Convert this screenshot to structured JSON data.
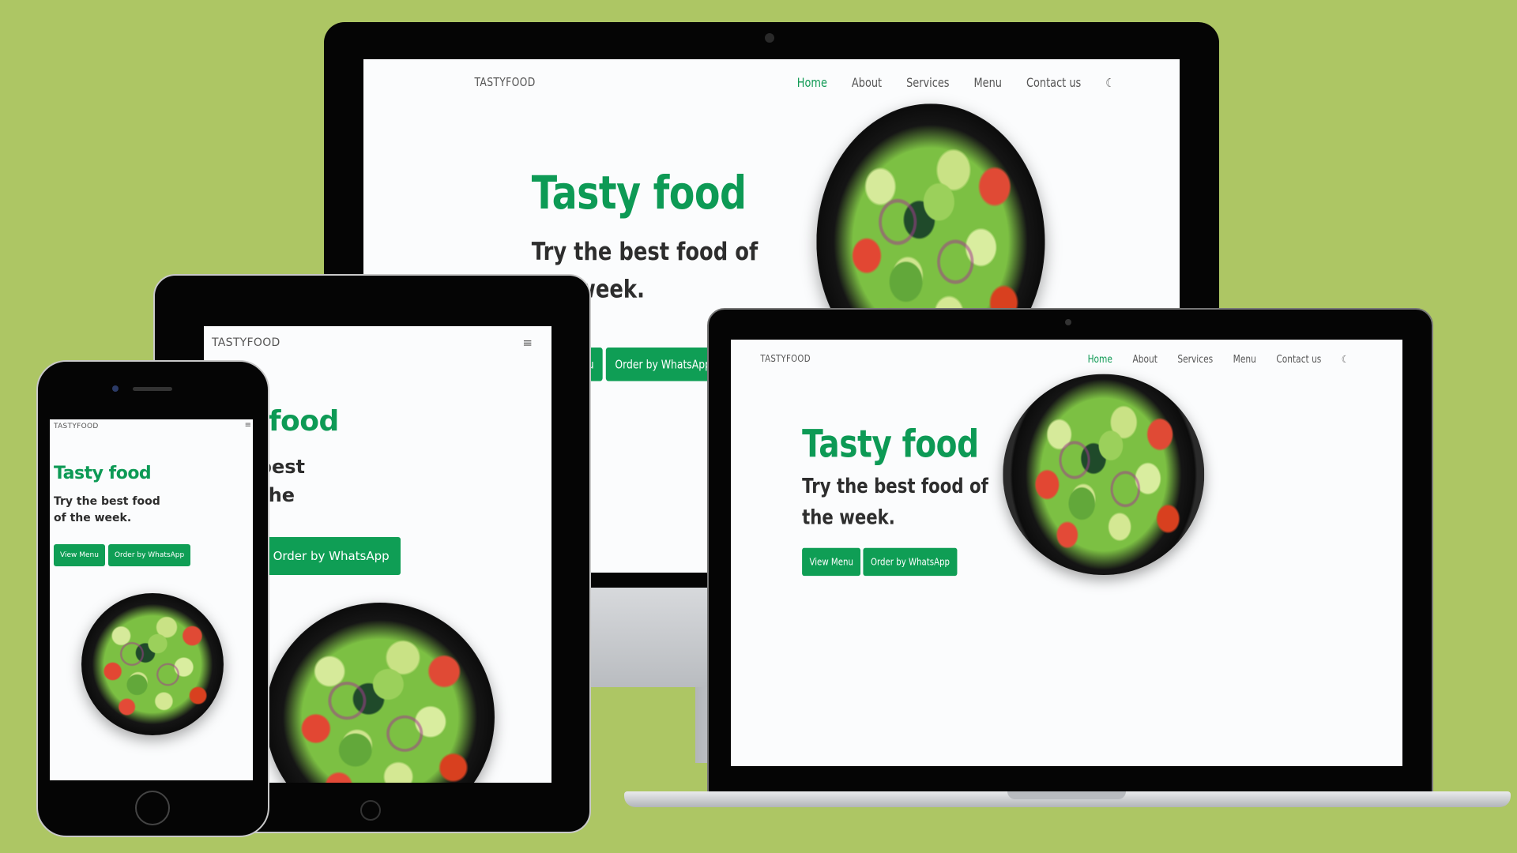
{
  "site": {
    "logo": "TASTYFOOD",
    "nav": [
      "Home",
      "About",
      "Services",
      "Menu",
      "Contact us"
    ],
    "active_nav": "Home",
    "theme_icon": "moon-icon",
    "menu_icon": "hamburger-icon",
    "hero_title": "Tasty food",
    "hero_subtitle": "Try the best food of the week.",
    "btn_menu": "View Menu",
    "btn_whatsapp": "Order by WhatsApp",
    "image": "salad-bowl"
  },
  "colors": {
    "background": "#adc664",
    "accent": "#0f9e55",
    "text_dark": "#2d2d2d"
  }
}
